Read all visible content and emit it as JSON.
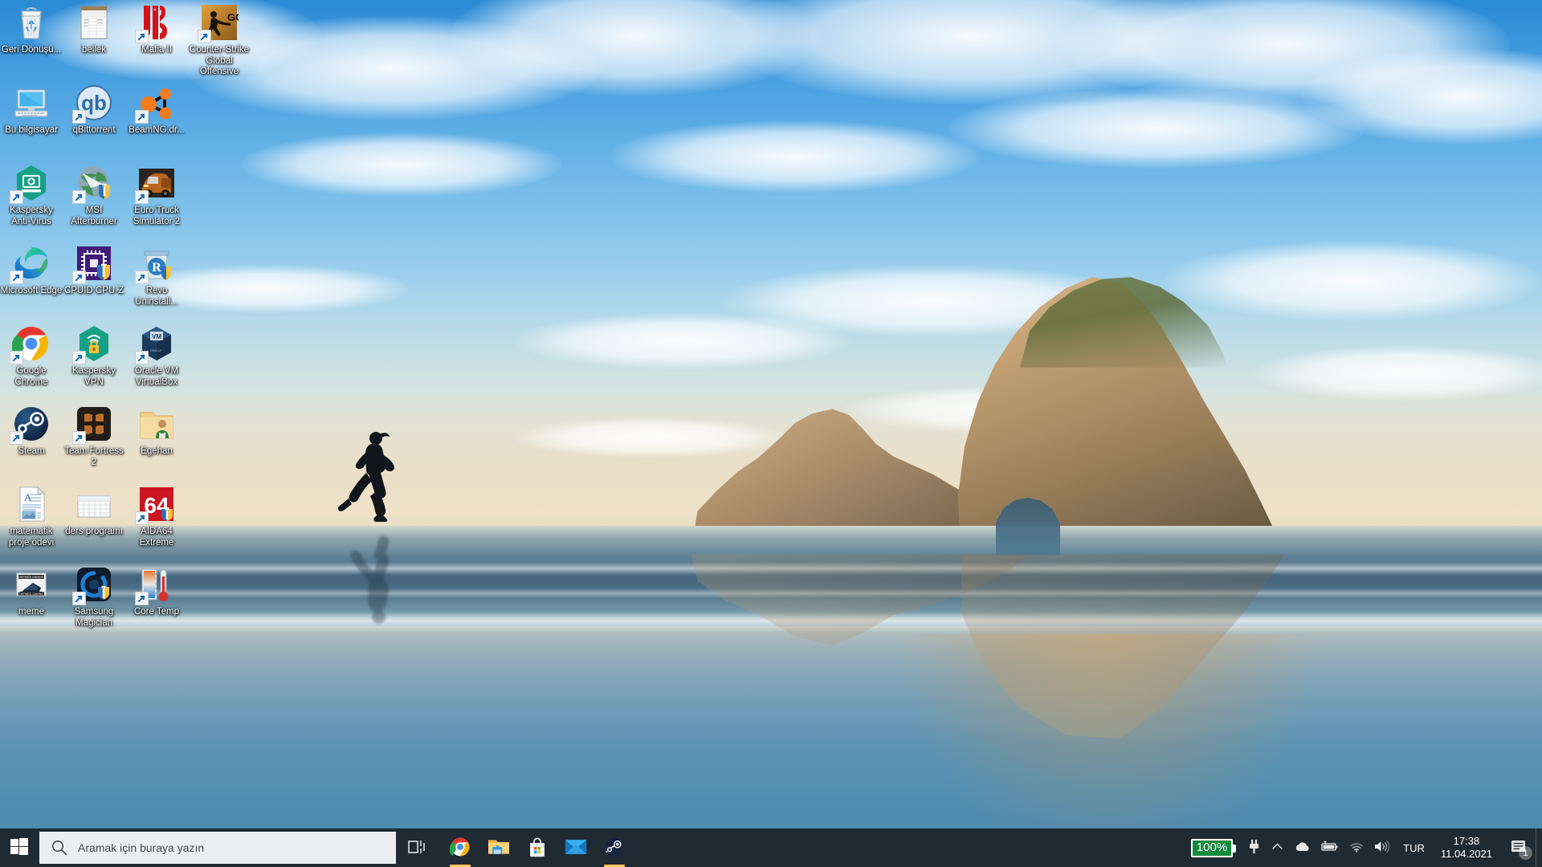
{
  "desktop": {
    "wallpaper_name": "wharariki-beach-runner",
    "icons": [
      {
        "label": "Geri Dönüşü...",
        "icon": "recycle-bin-icon",
        "shortcut": false,
        "col": 0,
        "row": 0
      },
      {
        "label": "bellek",
        "icon": "spreadsheet-document-icon",
        "shortcut": false,
        "col": 1,
        "row": 0
      },
      {
        "label": "Mafia II",
        "icon": "mafia-2-icon",
        "shortcut": true,
        "col": 2,
        "row": 0
      },
      {
        "label": "Counter-Strike Global Offensive",
        "icon": "counter-strike-go-icon",
        "shortcut": true,
        "col": 3,
        "row": 0
      },
      {
        "label": "Bu bilgisayar",
        "icon": "this-pc-icon",
        "shortcut": false,
        "col": 0,
        "row": 1
      },
      {
        "label": "qBittorrent",
        "icon": "qbittorrent-icon",
        "shortcut": true,
        "col": 1,
        "row": 1
      },
      {
        "label": "BeamNG.dr...",
        "icon": "beamng-drive-icon",
        "shortcut": true,
        "col": 2,
        "row": 1
      },
      {
        "label": "Kaspersky Anti-Virus",
        "icon": "kaspersky-antivirus-icon",
        "shortcut": true,
        "col": 0,
        "row": 2
      },
      {
        "label": "MSI Afterburner",
        "icon": "msi-afterburner-icon",
        "shortcut": true,
        "col": 1,
        "row": 2
      },
      {
        "label": "Euro Truck Simulator 2",
        "icon": "euro-truck-simulator-2-icon",
        "shortcut": true,
        "col": 2,
        "row": 2
      },
      {
        "label": "Microsoft Edge",
        "icon": "microsoft-edge-icon",
        "shortcut": true,
        "col": 0,
        "row": 3
      },
      {
        "label": "CPUID CPU-Z",
        "icon": "cpu-z-icon",
        "shortcut": true,
        "col": 1,
        "row": 3
      },
      {
        "label": "Revo Uninstall...",
        "icon": "revo-uninstaller-icon",
        "shortcut": true,
        "col": 2,
        "row": 3
      },
      {
        "label": "Google Chrome",
        "icon": "google-chrome-icon",
        "shortcut": true,
        "col": 0,
        "row": 4
      },
      {
        "label": "Kaspersky VPN",
        "icon": "kaspersky-vpn-icon",
        "shortcut": true,
        "col": 1,
        "row": 4
      },
      {
        "label": "Oracle VM VirtualBox",
        "icon": "virtualbox-icon",
        "shortcut": true,
        "col": 2,
        "row": 4
      },
      {
        "label": "Steam",
        "icon": "steam-icon",
        "shortcut": true,
        "col": 0,
        "row": 5
      },
      {
        "label": "Team Fortress 2",
        "icon": "team-fortress-2-icon",
        "shortcut": true,
        "col": 1,
        "row": 5
      },
      {
        "label": "Egehan",
        "icon": "user-folder-icon",
        "shortcut": false,
        "col": 2,
        "row": 5
      },
      {
        "label": "matematik proje ödevi",
        "icon": "word-document-icon",
        "shortcut": false,
        "col": 0,
        "row": 6
      },
      {
        "label": "ders programı",
        "icon": "table-document-icon",
        "shortcut": false,
        "col": 1,
        "row": 6
      },
      {
        "label": "AIDA64 Extreme",
        "icon": "aida64-extreme-icon",
        "shortcut": true,
        "col": 2,
        "row": 6
      },
      {
        "label": "meme",
        "icon": "image-file-icon",
        "shortcut": false,
        "col": 0,
        "row": 7
      },
      {
        "label": "Samsung Magician",
        "icon": "samsung-magician-icon",
        "shortcut": true,
        "col": 1,
        "row": 7
      },
      {
        "label": "Core Temp",
        "icon": "core-temp-icon",
        "shortcut": true,
        "col": 2,
        "row": 7
      }
    ]
  },
  "taskbar": {
    "start_label": "Başlat",
    "start_icon": "windows-logo-icon",
    "search": {
      "icon": "search-icon",
      "placeholder": "Aramak için buraya yazın",
      "value": ""
    },
    "buttons": [
      {
        "label": "Görev Görünümü",
        "icon": "task-view-icon",
        "active": false,
        "running": false
      },
      {
        "label": "Google Chrome",
        "icon": "google-chrome-icon",
        "active": false,
        "running": true
      },
      {
        "label": "Dosya Gezgini",
        "icon": "file-explorer-icon",
        "active": false,
        "running": false
      },
      {
        "label": "Microsoft Store",
        "icon": "microsoft-store-icon",
        "active": false,
        "running": false
      },
      {
        "label": "Posta",
        "icon": "mail-icon",
        "active": false,
        "running": false
      },
      {
        "label": "Steam",
        "icon": "steam-icon",
        "active": false,
        "running": true
      }
    ],
    "tray": {
      "battery_percent": "100%",
      "battery_badge_color": "#138a3e",
      "items": [
        {
          "name": "power-plug-icon",
          "label": "Güç"
        },
        {
          "name": "chevron-up-icon",
          "label": "Gizli simgeleri göster"
        },
        {
          "name": "onedrive-cloud-icon",
          "label": "OneDrive"
        },
        {
          "name": "battery-icon",
          "label": "Pil"
        },
        {
          "name": "wifi-icon",
          "label": "Ağ"
        },
        {
          "name": "volume-icon",
          "label": "Ses"
        }
      ],
      "language": "TUR",
      "time": "17:38",
      "date": "11.04.2021",
      "notification_icon": "notification-center-icon",
      "notification_count": "1"
    }
  }
}
